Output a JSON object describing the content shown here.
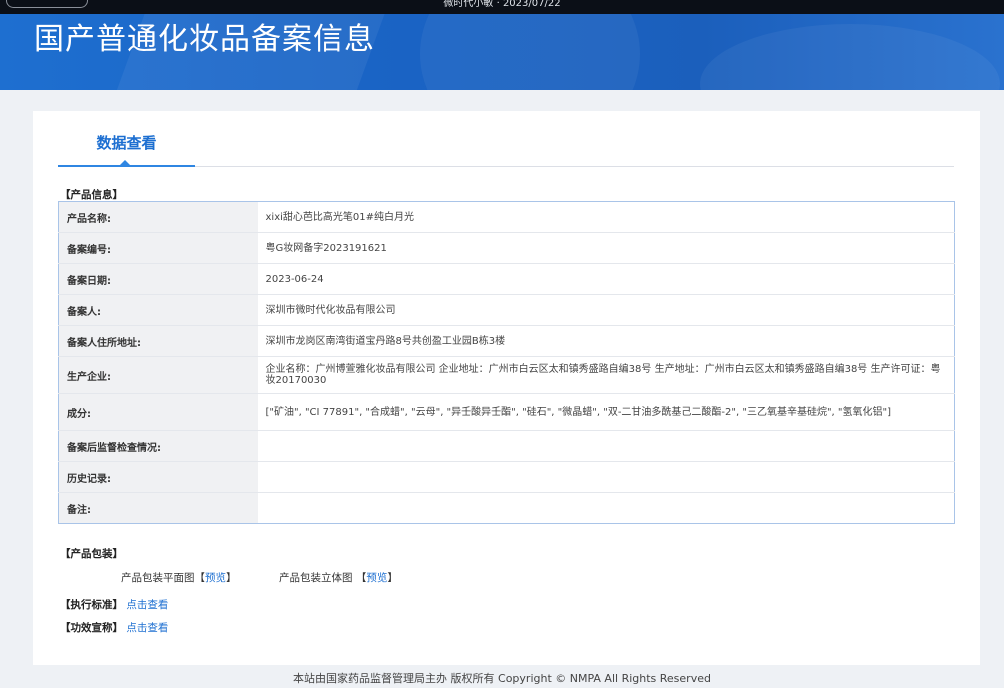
{
  "topbar": {
    "title": "微时代小敏 · 2023/07/22"
  },
  "banner": {
    "title": "国产普通化妆品备案信息"
  },
  "tabs": [
    {
      "label": "数据查看"
    }
  ],
  "product_info": {
    "section_label": "【产品信息】",
    "rows": [
      {
        "label": "产品名称:",
        "value": "xixi甜心芭比高光笔01#纯白月光"
      },
      {
        "label": "备案编号:",
        "value": "粤G妆网备字2023191621"
      },
      {
        "label": "备案日期:",
        "value": "2023-06-24"
      },
      {
        "label": "备案人:",
        "value": "深圳市微时代化妆品有限公司"
      },
      {
        "label": "备案人住所地址:",
        "value": "深圳市龙岗区南湾街道宝丹路8号共创盈工业园B栋3楼"
      },
      {
        "label": "生产企业:",
        "value": "企业名称：广州博萱雅化妆品有限公司 企业地址：广州市白云区太和镇秀盛路自编38号 生产地址：广州市白云区太和镇秀盛路自编38号 生产许可证：粤妆20170030"
      },
      {
        "label": "成分:",
        "value": "[\"矿油\", \"CI 77891\", \"合成蜡\", \"云母\", \"异壬酸异壬酯\", \"硅石\", \"微晶蜡\", \"双-二甘油多酰基己二酸酯-2\", \"三乙氧基辛基硅烷\", \"氢氧化铝\"]"
      },
      {
        "label": "备案后监督检查情况:",
        "value": ""
      },
      {
        "label": "历史记录:",
        "value": ""
      },
      {
        "label": "备注:",
        "value": ""
      }
    ]
  },
  "packaging": {
    "section_label": "【产品包装】",
    "flat_label": "产品包装平面图",
    "solid_label": "产品包装立体图",
    "bracket_open": "【",
    "bracket_close": "】",
    "preview_link": "预览"
  },
  "standards": {
    "exec_label": "【执行标准】",
    "efficacy_label": "【功效宣称】",
    "view_link": "点击查看"
  },
  "footer": {
    "text": "本站由国家药品监督管理局主办 版权所有 Copyright © NMPA All Rights Reserved"
  }
}
